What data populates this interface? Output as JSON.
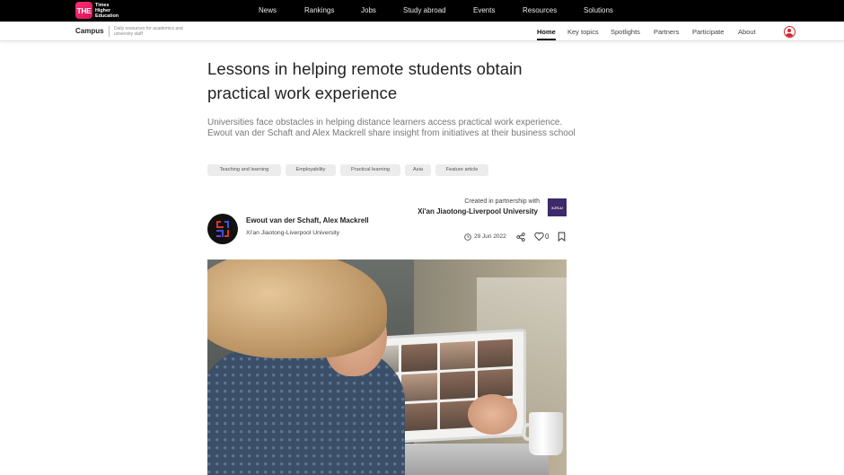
{
  "brand": {
    "logo_text": "THE",
    "name_lines": [
      "Times",
      "Higher",
      "Education"
    ],
    "logo_color": "#e01864"
  },
  "top_nav": [
    "News",
    "Rankings",
    "Jobs",
    "Study abroad",
    "Events",
    "Resources",
    "Solutions"
  ],
  "campus_nav": {
    "title": "Campus",
    "description": "Daily resources for academics and university staff",
    "links": [
      "Home",
      "Key topics",
      "Spotlights",
      "Partners",
      "Participate",
      "About"
    ],
    "active": "Home",
    "user_icon": "user-icon"
  },
  "article": {
    "title": "Lessons in helping remote students obtain practical work experience",
    "standfirst": "Universities face obstacles in helping distance learners access practical work experience. Ewout van der Schaft and Alex Mackrell share insight from initiatives at their business school",
    "tags": [
      "Teaching and learning",
      "Employability",
      "Practical learning",
      "Asia",
      "Feature article"
    ],
    "partner_label": "Created in partnership with",
    "partner_name": "Xi'an Jiaotong-Liverpool University",
    "partner_logo_text": "XJTLU",
    "authors": "Ewout van der Schaft, Alex Mackrell",
    "institution": "Xi'an Jiaotong-Liverpool University",
    "date": "29 Jun 2022",
    "likes": "0",
    "icons": [
      "clock-icon",
      "share-icon",
      "heart-icon",
      "bookmark-icon"
    ]
  }
}
